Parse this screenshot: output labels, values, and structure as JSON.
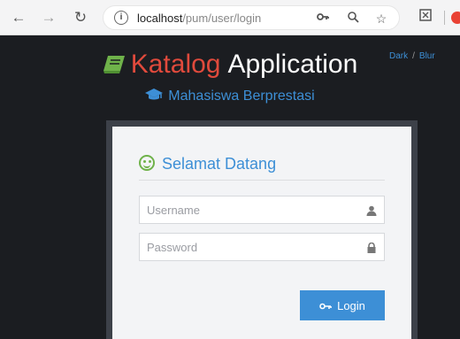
{
  "browser": {
    "url_host": "localhost",
    "url_path": "/pum/user/login"
  },
  "theme_switch": {
    "dark_label": "Dark",
    "separator": "/",
    "blue_label": "Blur"
  },
  "header": {
    "brand_name": "Katalog",
    "brand_app": "Application",
    "subtitle": "Mahasiswa Berprestasi"
  },
  "login": {
    "welcome": "Selamat Datang",
    "username_placeholder": "Username",
    "username_value": "",
    "password_placeholder": "Password",
    "password_value": "",
    "button_label": "Login"
  },
  "colors": {
    "accent": "#3d8fd6",
    "brand_red": "#e04a3c",
    "book_green": "#6fb24a",
    "page_bg": "#1b1d21"
  },
  "icons": [
    "back-icon",
    "forward-icon",
    "reload-icon",
    "info-icon",
    "key-icon",
    "zoom-icon",
    "star-icon",
    "book-icon",
    "graduation-cap-icon",
    "smile-icon",
    "user-icon",
    "lock-icon"
  ]
}
